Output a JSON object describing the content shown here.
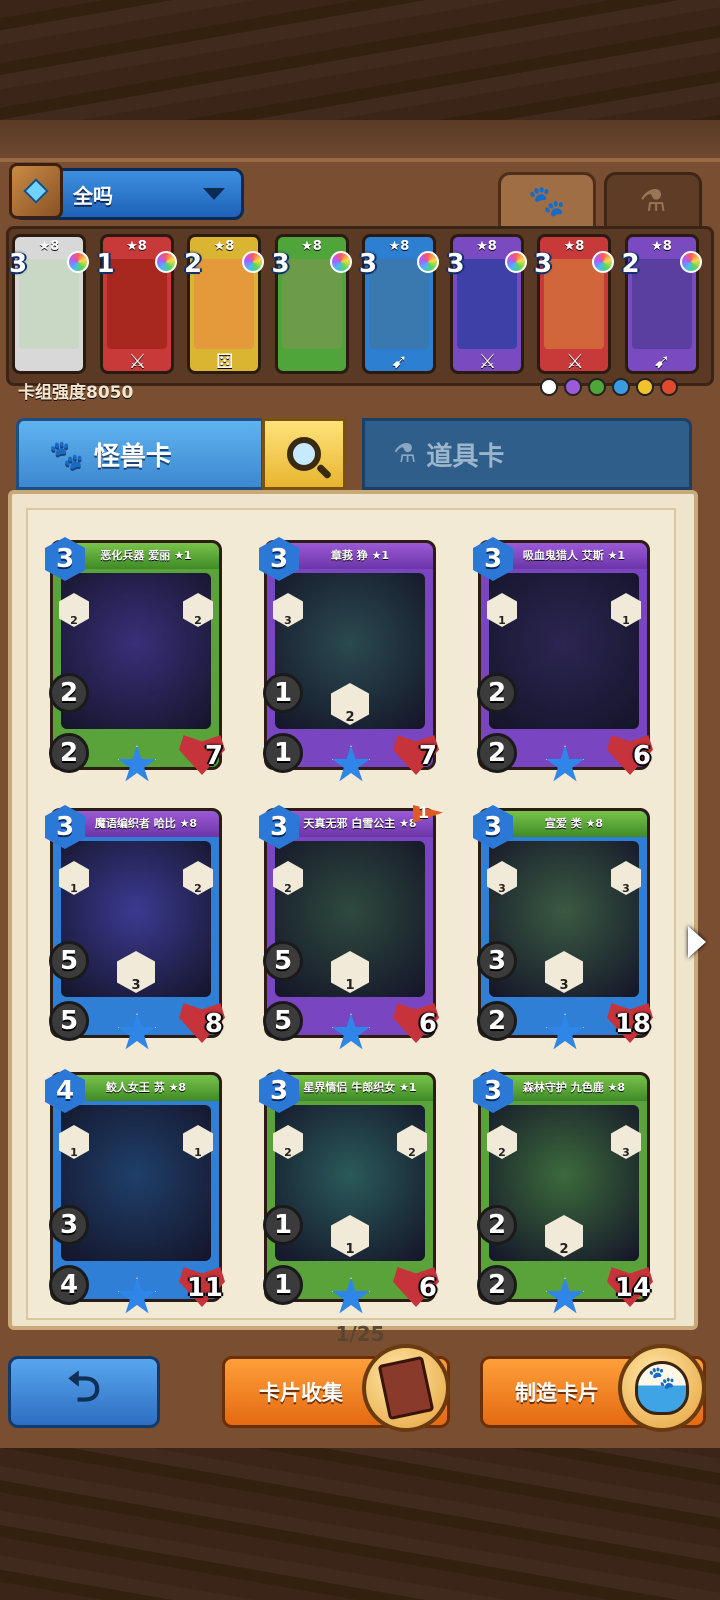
{
  "deck": {
    "name": "全吗",
    "power_label": "卡组强度8050"
  },
  "top_tabs": {
    "monster_icon": "paw-icon",
    "item_icon": "potion-icon"
  },
  "mini_cards": [
    {
      "cost": "3",
      "stars": "★8",
      "color": "#d8d8d8",
      "art": "#c9d7c5",
      "bottom": ""
    },
    {
      "cost": "1",
      "stars": "★8",
      "color": "#c8393a",
      "art": "#a8281f",
      "bottom": "⚔"
    },
    {
      "cost": "2",
      "stars": "★8",
      "color": "#d9b532",
      "art": "#e49a3b",
      "bottom": "⚄"
    },
    {
      "cost": "3",
      "stars": "★8",
      "color": "#4fa53a",
      "art": "#6c9b4a",
      "bottom": ""
    },
    {
      "cost": "3",
      "stars": "★8",
      "color": "#2c7fd1",
      "art": "#3a78b0",
      "bottom": "➹"
    },
    {
      "cost": "3",
      "stars": "★8",
      "color": "#7a4ac0",
      "art": "#3f3fa8",
      "bottom": "⚔"
    },
    {
      "cost": "3",
      "stars": "★8",
      "color": "#c8393a",
      "art": "#d0663a",
      "bottom": "⚔"
    },
    {
      "cost": "2",
      "stars": "★8",
      "color": "#7a4ac0",
      "art": "#5a3fa0",
      "bottom": "➹"
    }
  ],
  "element_colors": [
    "#ffffff",
    "#9b5ad6",
    "#4fa53a",
    "#3a9be0",
    "#f2c12e",
    "#e04a2a"
  ],
  "categories": {
    "monster_label": "怪兽卡",
    "item_label": "道具卡"
  },
  "cards": [
    {
      "name": "恶化兵器 爱丽 ★1",
      "cost": "3",
      "move": "2",
      "atk": "2",
      "hp": "7",
      "bar": "green",
      "frame": "#5aa33a",
      "art": "#3a2f7a",
      "skill_l": "2",
      "skill_r": "2",
      "skill_c": ""
    },
    {
      "name": "章莪 狰 ★1",
      "cost": "3",
      "move": "1",
      "atk": "1",
      "hp": "7",
      "bar": "purple",
      "frame": "#7a45c0",
      "art": "#2a4a4f",
      "skill_l": "3",
      "skill_r": "",
      "skill_c": "2"
    },
    {
      "name": "吸血鬼猎人 艾斯 ★1",
      "cost": "3",
      "move": "2",
      "atk": "2",
      "hp": "6",
      "bar": "purple",
      "frame": "#7a45c0",
      "art": "#2c2552",
      "skill_l": "1",
      "skill_r": "1",
      "skill_c": ""
    },
    {
      "name": "魔语编织者 哈比 ★8",
      "cost": "3",
      "move": "5",
      "atk": "5",
      "hp": "8",
      "bar": "purple",
      "frame": "#2f7fd6",
      "art": "#3b3a92",
      "skill_l": "1",
      "skill_r": "2",
      "skill_c": "3"
    },
    {
      "name": "天真无邪 白雪公主 ★8",
      "cost": "3",
      "move": "5",
      "atk": "5",
      "hp": "6",
      "bar": "purple",
      "frame": "#7a45c0",
      "art": "#2e4a3e",
      "skill_l": "2",
      "skill_r": "",
      "skill_c": "1",
      "flag": "1"
    },
    {
      "name": "宣爱 类 ★8",
      "cost": "3",
      "move": "3",
      "atk": "2",
      "hp": "18",
      "bar": "green",
      "frame": "#2f7fd6",
      "art": "#3a5a42",
      "skill_l": "3",
      "skill_r": "3",
      "skill_c": "3"
    },
    {
      "name": "鲛人女王 苏 ★8",
      "cost": "4",
      "move": "3",
      "atk": "4",
      "hp": "11",
      "bar": "green",
      "frame": "#2f7fd6",
      "art": "#1f3f6a",
      "skill_l": "1",
      "skill_r": "1",
      "skill_c": ""
    },
    {
      "name": "星界情侣 牛郎织女 ★1",
      "cost": "3",
      "move": "1",
      "atk": "1",
      "hp": "6",
      "bar": "green",
      "frame": "#5aa33a",
      "art": "#2a5a5a",
      "skill_l": "2",
      "skill_r": "2",
      "skill_c": "1"
    },
    {
      "name": "森林守护 九色鹿 ★8",
      "cost": "3",
      "move": "2",
      "atk": "2",
      "hp": "14",
      "bar": "green",
      "frame": "#5aa33a",
      "art": "#3c6a3c",
      "skill_l": "2",
      "skill_r": "3",
      "skill_c": "2"
    }
  ],
  "pager": "1/25",
  "buttons": {
    "collect": "卡片收集",
    "craft": "制造卡片",
    "back_icon": "back-arrow-icon"
  }
}
